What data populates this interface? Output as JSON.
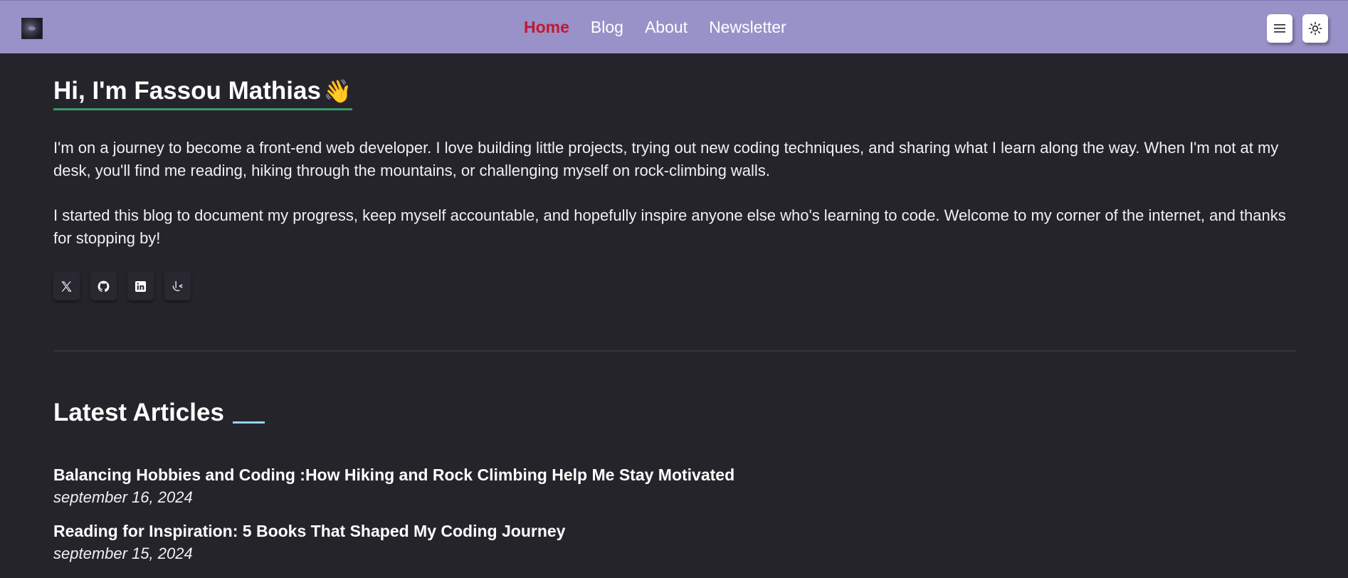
{
  "nav": {
    "logo_icon": "logo-image",
    "links": [
      {
        "label": "Home",
        "active": true
      },
      {
        "label": "Blog",
        "active": false
      },
      {
        "label": "About",
        "active": false
      },
      {
        "label": "Newsletter",
        "active": false
      }
    ],
    "menu_icon": "hamburger-menu-icon",
    "theme_icon": "sun-icon",
    "active_color": "#c4172f",
    "background_color": "#9892c9"
  },
  "hero": {
    "title": "Hi, I'm Fassou Mathias",
    "wave_emoji": "👋",
    "paragraph_1": "I'm on a journey to become a front-end web developer. I love building little projects, trying out new coding techniques, and sharing what I learn along the way. When I'm not at my desk, you'll find me reading, hiking through the mountains, or challenging myself on rock-climbing walls.",
    "paragraph_2": "I started this blog to document my progress, keep myself accountable, and hopefully inspire anyone else who's learning to code. Welcome to my corner of the internet, and thanks for stopping by!",
    "underline_color": "#3a9b6e"
  },
  "socials": [
    {
      "icon": "x-twitter-icon"
    },
    {
      "icon": "github-icon"
    },
    {
      "icon": "linkedin-icon"
    },
    {
      "icon": "frontend-mentor-icon"
    }
  ],
  "articles_section": {
    "title": "Latest Articles",
    "accent_color": "#8fd6f0",
    "articles": [
      {
        "title": "Balancing Hobbies and Coding :How Hiking and Rock Climbing Help Me Stay Motivated",
        "date": "september 16, 2024"
      },
      {
        "title": "Reading for Inspiration: 5 Books That Shaped My Coding Journey",
        "date": "september 15, 2024"
      }
    ]
  },
  "page": {
    "background_color": "#26242b"
  }
}
